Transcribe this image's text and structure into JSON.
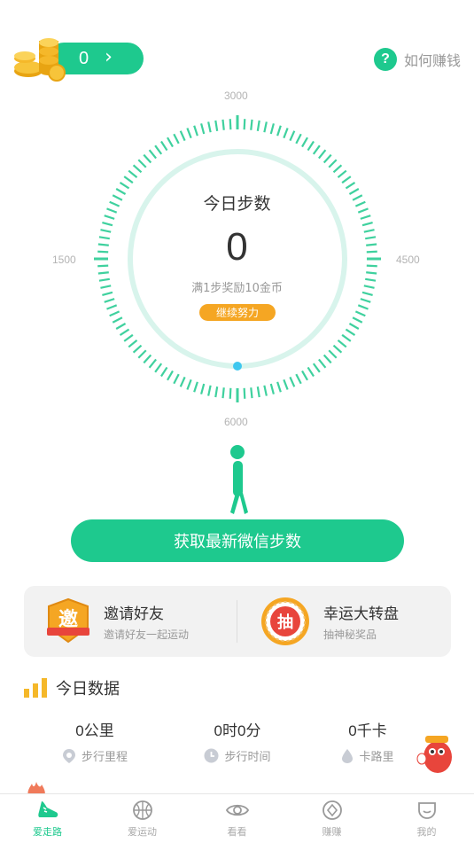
{
  "header": {
    "coin_count": "0",
    "help_label": "如何赚钱"
  },
  "dial": {
    "marks": {
      "top": "3000",
      "left": "1500",
      "right": "4500",
      "bottom": "6000"
    },
    "title": "今日步数",
    "steps": "0",
    "reward_text": "满1步奖励10金币",
    "badge": "继续努力",
    "progress": 0
  },
  "sync_button_label": "获取最新微信步数",
  "cards": {
    "invite": {
      "icon_text": "邀",
      "title": "邀请好友",
      "subtitle": "邀请好友一起运动"
    },
    "lottery": {
      "icon_text": "抽",
      "title": "幸运大转盘",
      "subtitle": "抽神秘奖品"
    }
  },
  "today": {
    "title": "今日数据",
    "stats": [
      {
        "value": "0公里",
        "label": "步行里程",
        "icon": "location-icon"
      },
      {
        "value": "0时0分",
        "label": "步行时间",
        "icon": "clock-icon"
      },
      {
        "value": "0千卡",
        "label": "卡路里",
        "icon": "flame-drop-icon"
      }
    ]
  },
  "nav": [
    {
      "label": "爱走路",
      "icon": "shoe-icon",
      "active": true
    },
    {
      "label": "爱运动",
      "icon": "basketball-icon",
      "active": false
    },
    {
      "label": "看看",
      "icon": "eye-icon",
      "active": false
    },
    {
      "label": "赚赚",
      "icon": "coin-diamond-icon",
      "active": false
    },
    {
      "label": "我的",
      "icon": "profile-icon",
      "active": false
    }
  ],
  "colors": {
    "accent": "#1ec98e",
    "badge_orange": "#f5a623",
    "tick_light": "#d8f4ec"
  }
}
